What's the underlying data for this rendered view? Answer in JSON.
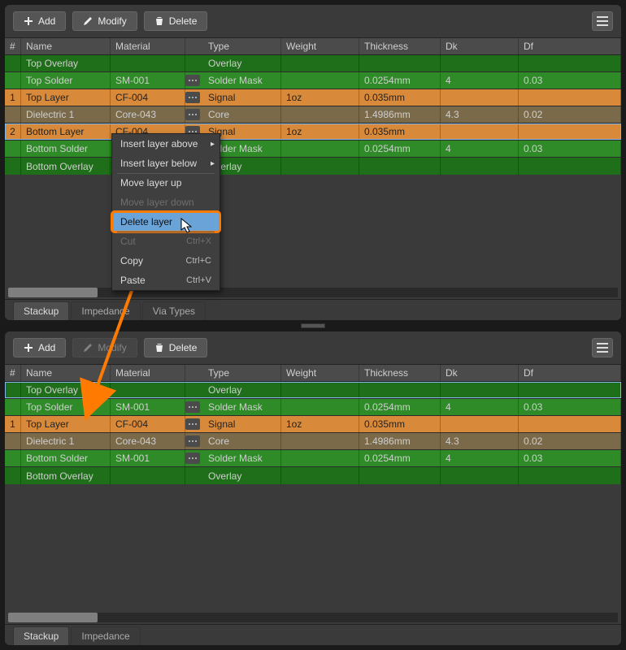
{
  "toolbar": {
    "add": "Add",
    "modify": "Modify",
    "delete": "Delete"
  },
  "columns": {
    "idx": "#",
    "name": "Name",
    "material": "Material",
    "type": "Type",
    "weight": "Weight",
    "thickness": "Thickness",
    "dk": "Dk",
    "df": "Df"
  },
  "manager1": {
    "tabs": [
      "Stackup",
      "Impedance",
      "Via Types"
    ],
    "rows": [
      {
        "idx": "",
        "name": "Top Overlay",
        "material": "",
        "type": "Overlay",
        "weight": "",
        "thickness": "",
        "dk": "",
        "df": "",
        "style": "row-green-dk"
      },
      {
        "idx": "",
        "name": "Top Solder",
        "material": "SM-001",
        "type": "Solder Mask",
        "weight": "",
        "thickness": "0.0254mm",
        "dk": "4",
        "df": "0.03",
        "style": "row-green"
      },
      {
        "idx": "1",
        "name": "Top Layer",
        "material": "CF-004",
        "type": "Signal",
        "weight": "1oz",
        "thickness": "0.035mm",
        "dk": "",
        "df": "",
        "style": "row-orange"
      },
      {
        "idx": "",
        "name": "Dielectric 1",
        "material": "Core-043",
        "type": "Core",
        "weight": "",
        "thickness": "1.4986mm",
        "dk": "4.3",
        "df": "0.02",
        "style": "row-brown"
      },
      {
        "idx": "2",
        "name": "Bottom Layer",
        "material": "CF-004",
        "type": "Signal",
        "weight": "1oz",
        "thickness": "0.035mm",
        "dk": "",
        "df": "",
        "style": "row-orange row-orange-sel"
      },
      {
        "idx": "",
        "name": "Bottom Solder",
        "material": "SM-001",
        "type": "Solder Mask",
        "weight": "",
        "thickness": "0.0254mm",
        "dk": "4",
        "df": "0.03",
        "style": "row-green"
      },
      {
        "idx": "",
        "name": "Bottom Overlay",
        "material": "",
        "type": "Overlay",
        "weight": "",
        "thickness": "",
        "dk": "",
        "df": "",
        "style": "row-green-dk"
      }
    ]
  },
  "manager2": {
    "tabs": [
      "Stackup",
      "Impedance"
    ],
    "rows": [
      {
        "idx": "",
        "name": "Top Overlay",
        "material": "",
        "type": "Overlay",
        "weight": "",
        "thickness": "",
        "dk": "",
        "df": "",
        "style": "row-green-dk row-green-sel"
      },
      {
        "idx": "",
        "name": "Top Solder",
        "material": "SM-001",
        "type": "Solder Mask",
        "weight": "",
        "thickness": "0.0254mm",
        "dk": "4",
        "df": "0.03",
        "style": "row-green"
      },
      {
        "idx": "1",
        "name": "Top Layer",
        "material": "CF-004",
        "type": "Signal",
        "weight": "1oz",
        "thickness": "0.035mm",
        "dk": "",
        "df": "",
        "style": "row-orange"
      },
      {
        "idx": "",
        "name": "Dielectric 1",
        "material": "Core-043",
        "type": "Core",
        "weight": "",
        "thickness": "1.4986mm",
        "dk": "4.3",
        "df": "0.02",
        "style": "row-brown"
      },
      {
        "idx": "",
        "name": "Bottom Solder",
        "material": "SM-001",
        "type": "Solder Mask",
        "weight": "",
        "thickness": "0.0254mm",
        "dk": "4",
        "df": "0.03",
        "style": "row-green"
      },
      {
        "idx": "",
        "name": "Bottom Overlay",
        "material": "",
        "type": "Overlay",
        "weight": "",
        "thickness": "",
        "dk": "",
        "df": "",
        "style": "row-green-dk"
      }
    ]
  },
  "context_menu": {
    "items": [
      {
        "label": "Insert layer above",
        "submenu": true,
        "sep": false
      },
      {
        "label": "Insert layer below",
        "submenu": true,
        "sep": true
      },
      {
        "label": "Move layer up",
        "submenu": false
      },
      {
        "label": "Move layer down",
        "submenu": false,
        "disabled": true,
        "sep": true
      },
      {
        "label": "Delete layer",
        "highlight": true,
        "sep": true
      },
      {
        "label": "Cut",
        "shortcut": "Ctrl+X",
        "disabled": true
      },
      {
        "label": "Copy",
        "shortcut": "Ctrl+C"
      },
      {
        "label": "Paste",
        "shortcut": "Ctrl+V"
      }
    ]
  }
}
